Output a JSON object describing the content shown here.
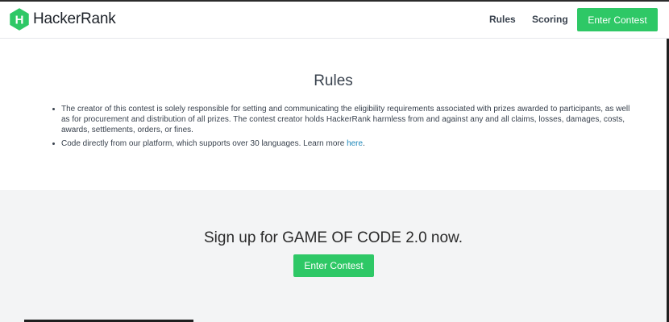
{
  "header": {
    "logo_text": "HackerRank",
    "logo_letter": "H",
    "nav": [
      {
        "label": "Rules"
      },
      {
        "label": "Scoring"
      }
    ],
    "enter_button": "Enter Contest"
  },
  "rules": {
    "title": "Rules",
    "items": [
      {
        "text": "The creator of this contest is solely responsible for setting and communicating the eligibility requirements associated with prizes awarded to participants, as well as for procurement and distribution of all prizes. The contest creator holds HackerRank harmless from and against any and all claims, losses, damages, costs, awards, settlements, orders, or fines."
      },
      {
        "text_before_link": "Code directly from our platform, which supports over 30 languages. Learn more ",
        "link": "here",
        "text_after_link": "."
      }
    ]
  },
  "signup": {
    "title": "Sign up for GAME OF CODE 2.0 now.",
    "button": "Enter Contest"
  },
  "colors": {
    "brand_green": "#2ec866",
    "link_blue": "#1e87b9",
    "text": "#39424e",
    "signup_bg": "#f3f4f5"
  }
}
